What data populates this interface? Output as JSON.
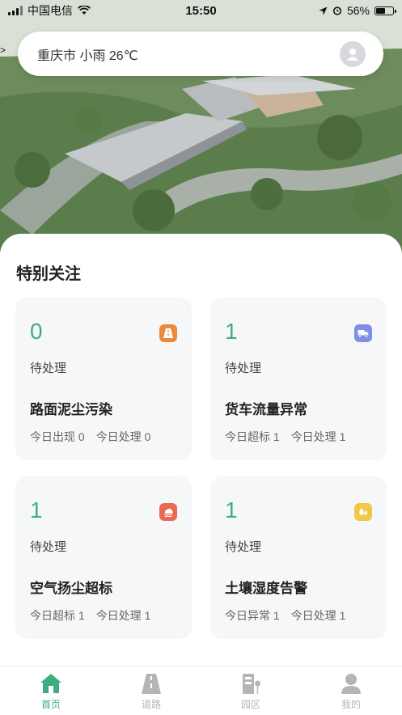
{
  "status_bar": {
    "carrier": "中国电信",
    "time": "15:50",
    "battery_percent": "56%",
    "battery_level": 0.56
  },
  "location_bar": {
    "city": "重庆市",
    "weather": "小雨",
    "temperature": "26℃",
    "text": "重庆市 小雨 26℃"
  },
  "section": {
    "title": "特别关注"
  },
  "cards": [
    {
      "count": "0",
      "pending_label": "待处理",
      "title": "路面泥尘污染",
      "stat1": "今日出现 0",
      "stat2": "今日处理 0",
      "icon": "road-icon",
      "color": "#ea8a3f"
    },
    {
      "count": "1",
      "pending_label": "待处理",
      "title": "货车流量异常",
      "stat1": "今日超标 1",
      "stat2": "今日处理 1",
      "icon": "truck-icon",
      "color": "#7f8ee6"
    },
    {
      "count": "1",
      "pending_label": "待处理",
      "title": "空气扬尘超标",
      "stat1": "今日超标 1",
      "stat2": "今日处理 1",
      "icon": "dust-cloud-icon",
      "color": "#e86a52"
    },
    {
      "count": "1",
      "pending_label": "待处理",
      "title": "土壤湿度告警",
      "stat1": "今日异常 1",
      "stat2": "今日处理 1",
      "icon": "water-drop-icon",
      "color": "#f1c84b"
    }
  ],
  "tabs": [
    {
      "label": "首页",
      "icon": "home-icon",
      "active": true
    },
    {
      "label": "道路",
      "icon": "road-icon",
      "active": false
    },
    {
      "label": "园区",
      "icon": "park-icon",
      "active": false
    },
    {
      "label": "我的",
      "icon": "user-icon",
      "active": false
    }
  ],
  "colors": {
    "accent": "#3fae7f",
    "card_bg": "#f6f7f9",
    "tab_inactive": "#b5b5b5"
  }
}
